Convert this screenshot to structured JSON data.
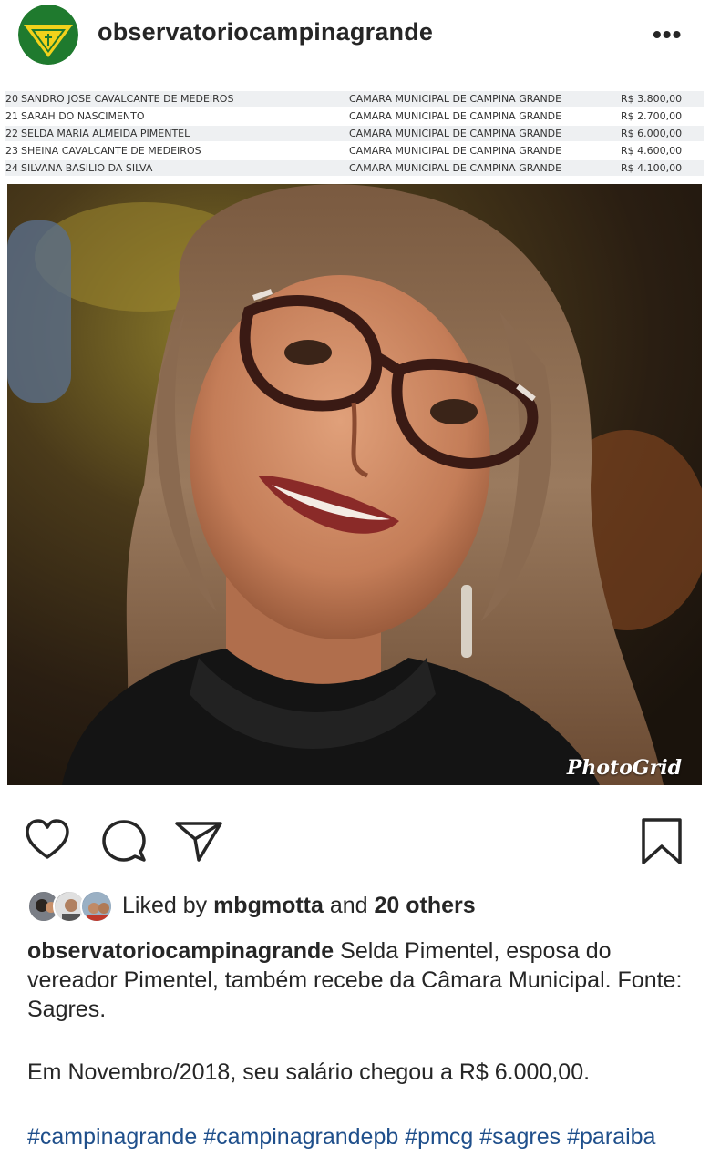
{
  "header": {
    "username": "observatoriocampinagrande",
    "more_glyph": "•••"
  },
  "table": {
    "rows": [
      {
        "idx": "20",
        "name": "SANDRO JOSE CAVALCANTE DE MEDEIROS",
        "org": "CAMARA MUNICIPAL DE CAMPINA GRANDE",
        "value": "R$ 3.800,00"
      },
      {
        "idx": "21",
        "name": "SARAH DO NASCIMENTO",
        "org": "CAMARA MUNICIPAL DE CAMPINA GRANDE",
        "value": "R$ 2.700,00"
      },
      {
        "idx": "22",
        "name": "SELDA MARIA ALMEIDA PIMENTEL",
        "org": "CAMARA MUNICIPAL DE CAMPINA GRANDE",
        "value": "R$ 6.000,00"
      },
      {
        "idx": "23",
        "name": "SHEINA CAVALCANTE DE MEDEIROS",
        "org": "CAMARA MUNICIPAL DE CAMPINA GRANDE",
        "value": "R$ 4.600,00"
      },
      {
        "idx": "24",
        "name": "SILVANA BASILIO DA SILVA",
        "org": "CAMARA MUNICIPAL DE CAMPINA GRANDE",
        "value": "R$ 4.100,00"
      }
    ]
  },
  "photo": {
    "watermark": "PhotoGrid"
  },
  "likes": {
    "prefix": "Liked by ",
    "user": "mbgmotta",
    "middle": " and ",
    "others": "20 others"
  },
  "caption": {
    "username": "observatoriocampinagrande",
    "text": " Selda Pimentel, esposa do vereador Pimentel, também recebe da Câmara Municipal. Fonte: Sagres.",
    "text2": "Em Novembro/2018, seu salário chegou a R$ 6.000,00.",
    "hashtags": [
      "#campinagrande",
      "#campinagrandepb",
      "#pmcg",
      "#sagres",
      "#paraiba"
    ]
  },
  "colors": {
    "logo_green": "#1f7a2e",
    "logo_yellow": "#f2d21b",
    "hashtag": "#1f4f8b"
  }
}
